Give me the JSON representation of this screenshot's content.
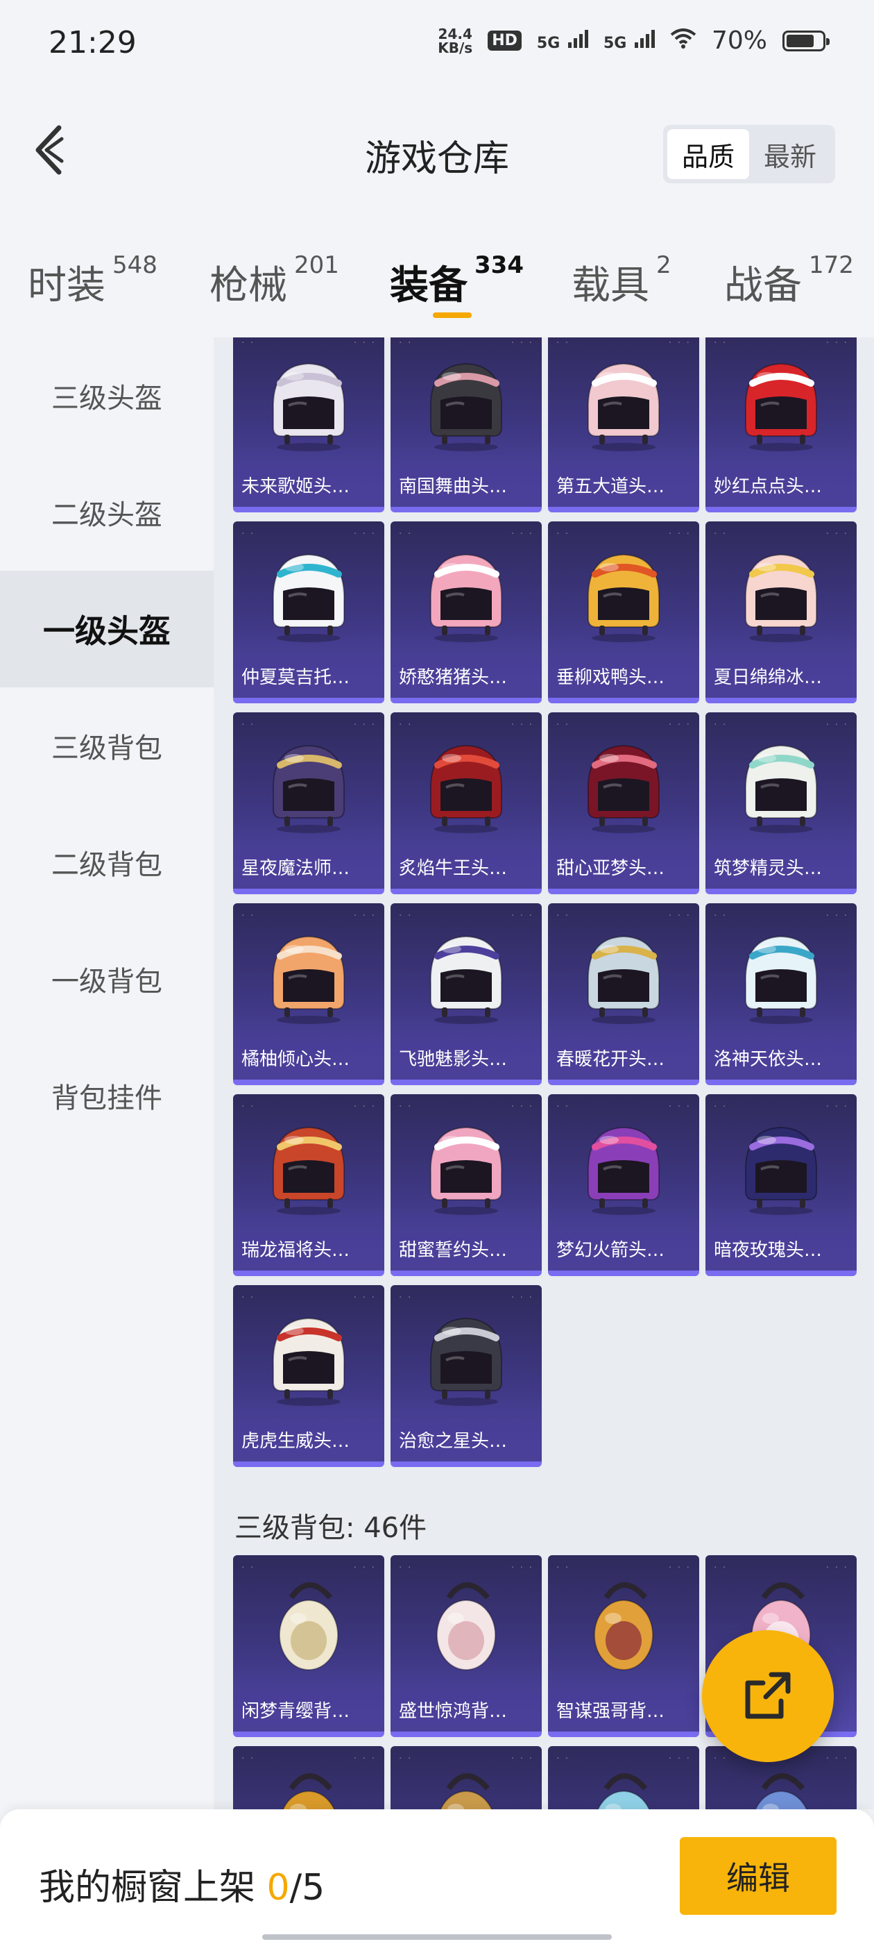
{
  "status_bar": {
    "time": "21:29",
    "net_speed_value": "24.4",
    "net_speed_unit": "KB/s",
    "hd_badge": "HD",
    "signal_1": "5G",
    "signal_2": "5G",
    "battery_percent": "70%",
    "battery_level": 0.7,
    "icons": [
      "wifi-icon",
      "battery-icon",
      "signal-icon"
    ]
  },
  "header": {
    "title": "游戏仓库",
    "sort_options": [
      "品质",
      "最新"
    ],
    "sort_selected": "品质"
  },
  "tabs": [
    {
      "label": "时装",
      "count": "548"
    },
    {
      "label": "枪械",
      "count": "201"
    },
    {
      "label": "装备",
      "count": "334",
      "active": true
    },
    {
      "label": "载具",
      "count": "2"
    },
    {
      "label": "战备",
      "count": "172"
    }
  ],
  "sidebar": {
    "items": [
      "三级头盔",
      "二级头盔",
      "一级头盔",
      "三级背包",
      "二级背包",
      "一级背包",
      "背包挂件"
    ],
    "active": "一级头盔"
  },
  "helmets": [
    {
      "name": "未来歌姬头…",
      "color": "#e9e6ef",
      "accent": "#c9c2d6"
    },
    {
      "name": "南国舞曲头…",
      "color": "#3b3940",
      "accent": "#d99aa8"
    },
    {
      "name": "第五大道头…",
      "color": "#f1c9cf",
      "accent": "#ffffff"
    },
    {
      "name": "妙红点点头…",
      "color": "#d8252a",
      "accent": "#ffffff"
    },
    {
      "name": "仲夏莫吉托…",
      "color": "#f4f6f8",
      "accent": "#2fb4cf"
    },
    {
      "name": "娇憨猪猪头…",
      "color": "#f3a7bd",
      "accent": "#ffffff"
    },
    {
      "name": "垂柳戏鸭头…",
      "color": "#f0b33a",
      "accent": "#e05624"
    },
    {
      "name": "夏日绵绵冰…",
      "color": "#f7d6d0",
      "accent": "#f1c84a"
    },
    {
      "name": "星夜魔法师…",
      "color": "#4b3d75",
      "accent": "#d7b76a"
    },
    {
      "name": "炙焰牛王头…",
      "color": "#9b1c20",
      "accent": "#e24b3a"
    },
    {
      "name": "甜心亚梦头…",
      "color": "#7a1528",
      "accent": "#e26b7f"
    },
    {
      "name": "筑梦精灵头…",
      "color": "#eef1ec",
      "accent": "#8fd7c9"
    },
    {
      "name": "橘柚倾心头…",
      "color": "#f2a56a",
      "accent": "#f7e0c9"
    },
    {
      "name": "飞驰魅影头…",
      "color": "#eef0f2",
      "accent": "#4b3f9c"
    },
    {
      "name": "春暖花开头…",
      "color": "#c9d7e0",
      "accent": "#d9b24a"
    },
    {
      "name": "洛神天依头…",
      "color": "#e6f3f9",
      "accent": "#3aa7c9"
    },
    {
      "name": "瑞龙福将头…",
      "color": "#c9462a",
      "accent": "#f1c66a"
    },
    {
      "name": "甜蜜誓约头…",
      "color": "#f0a6c0",
      "accent": "#ffffff"
    },
    {
      "name": "梦幻火箭头…",
      "color": "#8a3fb8",
      "accent": "#e24fa0"
    },
    {
      "name": "暗夜玫瑰头…",
      "color": "#2d2b6e",
      "accent": "#9a6ce0"
    },
    {
      "name": "虎虎生威头…",
      "color": "#f1ede6",
      "accent": "#c8342b"
    },
    {
      "name": "治愈之星头…",
      "color": "#3a3a46",
      "accent": "#c9cad3"
    }
  ],
  "backpack_section": {
    "heading": "三级背包: 46件",
    "items": [
      {
        "name": "闲梦青缨背…",
        "color": "#efe7cf",
        "accent": "#c9b37a"
      },
      {
        "name": "盛世惊鸿背…",
        "color": "#f4e6e6",
        "accent": "#d8a0aa"
      },
      {
        "name": "智谋强哥背…",
        "color": "#e2a03a",
        "accent": "#8a2a3a"
      },
      {
        "name": "",
        "color": "#f1b3c9",
        "accent": "#ffffff"
      },
      {
        "name": "",
        "color": "#d99a2a",
        "accent": "#5a3a1a"
      },
      {
        "name": "",
        "color": "#c99a4a",
        "accent": "#6a4a2a"
      },
      {
        "name": "",
        "color": "#8fd0e6",
        "accent": "#3a4a6a"
      },
      {
        "name": "",
        "color": "#6f8fd6",
        "accent": "#2a3a7a"
      }
    ]
  },
  "footer": {
    "label": "我的橱窗上架",
    "count": "0",
    "total": "/5",
    "edit_label": "编辑"
  }
}
